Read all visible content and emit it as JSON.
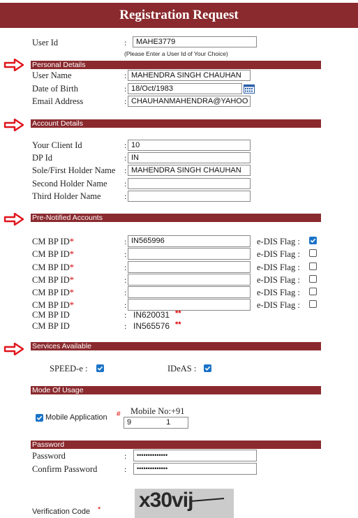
{
  "title": "Registration Request",
  "user_id": {
    "label": "User Id",
    "value": "MAHE3779",
    "hint": "(Please Enter a User Id of Your Choice)"
  },
  "personal": {
    "heading": "Personal Details",
    "user_name": {
      "label": "User Name",
      "value": "MAHENDRA SINGH CHAUHAN"
    },
    "dob": {
      "label": "Date of Birth",
      "value": "18/Oct/1983"
    },
    "email": {
      "label": "Email Address",
      "value": "CHAUHANMAHENDRA@YAHOO"
    }
  },
  "account": {
    "heading": "Account Details",
    "client_id": {
      "label": "Your Client Id",
      "value": "10"
    },
    "dp_id": {
      "label": "DP Id",
      "value": "IN"
    },
    "first_holder": {
      "label": "Sole/First Holder Name",
      "value": "MAHENDRA SINGH CHAUHAN"
    },
    "second_holder": {
      "label": "Second Holder Name",
      "value": ""
    },
    "third_holder": {
      "label": "Third Holder Name",
      "value": ""
    }
  },
  "pre_notified": {
    "heading": "Pre-Notified Accounts",
    "bp_label": "CM BP ID",
    "req_mark": "*",
    "edis_label": "e-DIS Flag :",
    "rows": [
      {
        "value": "IN565996",
        "edis": true
      },
      {
        "value": "",
        "edis": false
      },
      {
        "value": "",
        "edis": false
      },
      {
        "value": "",
        "edis": false
      },
      {
        "value": "",
        "edis": false
      },
      {
        "value": "",
        "edis": false
      }
    ],
    "fixed": [
      {
        "label": "CM BP ID",
        "value": "IN620031",
        "mark": "**"
      },
      {
        "label": "CM BP ID",
        "value": "IN565576",
        "mark": "**"
      }
    ]
  },
  "services": {
    "heading": "Services Available",
    "speed_e": {
      "label": "SPEED-e :",
      "checked": true
    },
    "ideas": {
      "label": "IDeAS :",
      "checked": true
    }
  },
  "mode": {
    "heading": "Mode Of Usage",
    "mobile_app": {
      "label": "Mobile Application",
      "mark": "#",
      "checked": true
    },
    "mobile_no_label": "Mobile No:+91",
    "mobile_no_value": "9",
    "mobile_no_tail": "1"
  },
  "password": {
    "heading": "Password",
    "password": {
      "label": "Password",
      "value": "••••••••••••••"
    },
    "confirm": {
      "label": "Confirm Password",
      "value": "••••••••••••••"
    }
  },
  "verification": {
    "label": "Verification Code",
    "mark": "*",
    "captcha_text": "x30vij"
  },
  "colors": {
    "accent": "#8a2a2e",
    "arrow": "#e0141b",
    "check": "#1a73c8"
  },
  "icons": {
    "pointer": "right-arrow-icon",
    "calendar": "calendar-icon"
  }
}
